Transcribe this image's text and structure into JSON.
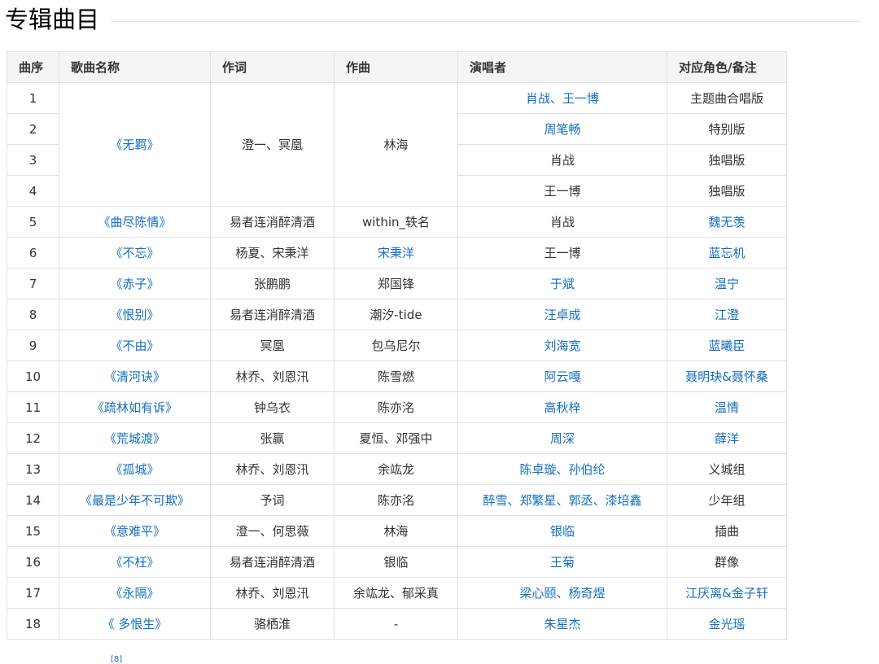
{
  "section": {
    "title": "专辑曲目"
  },
  "colors": {
    "link": "#136ec2",
    "header_bg": "#f4f5f7",
    "border": "#e1e1e1"
  },
  "table": {
    "headers": [
      "曲序",
      "歌曲名称",
      "作词",
      "作曲",
      "演唱者",
      "对应角色/备注"
    ],
    "group": {
      "song": "《无羁》",
      "lyricist": "澄一、冥凰",
      "composer": "林海"
    },
    "group_rows": [
      {
        "no": "1",
        "singer": "肖战、王一博",
        "note": "主题曲合唱版"
      },
      {
        "no": "2",
        "singer": "周笔畅",
        "note": "特别版"
      },
      {
        "no": "3",
        "singer": "肖战",
        "note": "独唱版"
      },
      {
        "no": "4",
        "singer": "王一博",
        "note": "独唱版"
      }
    ],
    "rows": [
      {
        "no": "5",
        "song": "《曲尽陈情》",
        "lyricist": "易者连消醉清酒",
        "composer": "within_轶名",
        "singer": "肖战",
        "note": "魏无羡"
      },
      {
        "no": "6",
        "song": "《不忘》",
        "lyricist": "杨夏、宋秉洋",
        "composer": "宋秉洋",
        "singer": "王一博",
        "note": "蓝忘机"
      },
      {
        "no": "7",
        "song": "《赤子》",
        "lyricist": "张鹏鹏",
        "composer": "郑国锋",
        "singer": "于斌",
        "note": "温宁"
      },
      {
        "no": "8",
        "song": "《恨别》",
        "lyricist": "易者连消醉清酒",
        "composer": "潮汐-tide",
        "singer": "汪卓成",
        "note": "江澄"
      },
      {
        "no": "9",
        "song": "《不由》",
        "lyricist": "冥凰",
        "composer": "包乌尼尔",
        "singer": "刘海宽",
        "note": "蓝曦臣"
      },
      {
        "no": "10",
        "song": "《清河诀》",
        "lyricist": "林乔、刘恩汛",
        "composer": "陈雪燃",
        "singer": "阿云嘎",
        "note": "聂明玦&聂怀桑"
      },
      {
        "no": "11",
        "song": "《疏林如有诉》",
        "lyricist": "钟乌衣",
        "composer": "陈亦洺",
        "singer": "高秋梓",
        "note": "温情"
      },
      {
        "no": "12",
        "song": "《荒城渡》",
        "lyricist": "张赢",
        "composer": "夏恒、邓强中",
        "singer": "周深",
        "note": "薛洋"
      },
      {
        "no": "13",
        "song": "《孤城》",
        "lyricist": "林乔、刘恩汛",
        "composer": "余竑龙",
        "singer": "陈卓璇、孙伯纶",
        "note": "义城组"
      },
      {
        "no": "14",
        "song": "《最是少年不可欺》",
        "lyricist": "予词",
        "composer": "陈亦洺",
        "singer": "醉雪、郑繁星、郭丞、漆培鑫",
        "note": "少年组"
      },
      {
        "no": "15",
        "song": "《意难平》",
        "lyricist": "澄一、何思薇",
        "composer": "林海",
        "singer": "银临",
        "note": "插曲"
      },
      {
        "no": "16",
        "song": "《不枉》",
        "lyricist": "易者连消醉清酒",
        "composer": "银临",
        "singer": "王菊",
        "note": "群像"
      },
      {
        "no": "17",
        "song": "《永隔》",
        "lyricist": "林乔、刘恩汛",
        "composer": "余竑龙、郁采真",
        "singer": "梁心颐、杨奇煜",
        "note": "江厌离&金子轩"
      },
      {
        "no": "18",
        "song": "《 多恨生》",
        "lyricist": "骆栖淮",
        "composer": "-",
        "singer": "朱星杰",
        "note": "金光瑶"
      }
    ]
  },
  "footnote": "[8]"
}
